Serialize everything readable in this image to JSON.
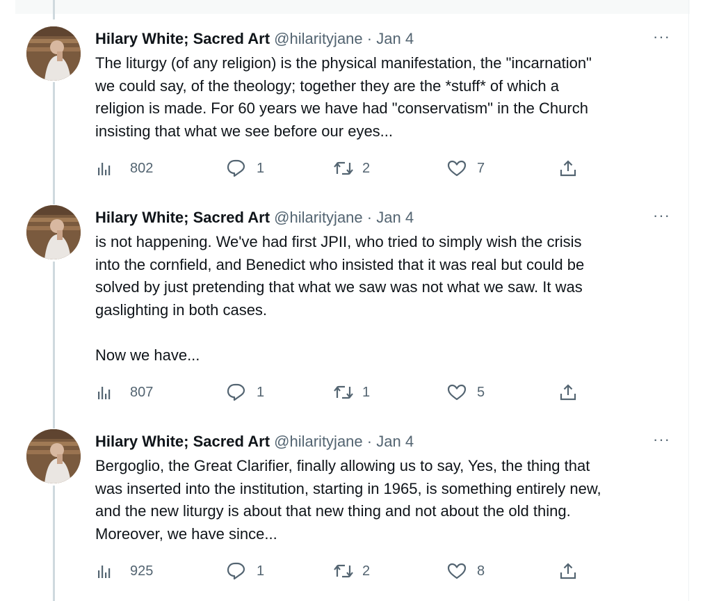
{
  "tweets": [
    {
      "author": "Hilary White; Sacred Art",
      "handle": "@hilarityjane",
      "separator": "·",
      "date": "Jan 4",
      "more": "···",
      "text": "The liturgy (of any religion) is the physical manifestation, the \"incarnation\"\nwe could say, of the theology; together they are the *stuff* of which a\nreligion is made. For 60 years we have had \"conservatism\" in the Church\ninsisting that what we see before our eyes...",
      "views": "802",
      "replies": "1",
      "retweets": "2",
      "likes": "7"
    },
    {
      "author": "Hilary White; Sacred Art",
      "handle": "@hilarityjane",
      "separator": "·",
      "date": "Jan 4",
      "more": "···",
      "text": "is not happening. We've had first JPII, who tried to simply wish the crisis\ninto the cornfield, and Benedict who insisted that it was real but could be\nsolved by just pretending that what we saw was not what we saw. It was\ngaslighting in both cases.\n\nNow we have...",
      "views": "807",
      "replies": "1",
      "retweets": "1",
      "likes": "5"
    },
    {
      "author": "Hilary White; Sacred Art",
      "handle": "@hilarityjane",
      "separator": "·",
      "date": "Jan 4",
      "more": "···",
      "text": "Bergoglio, the Great Clarifier, finally allowing us to say, Yes, the thing that\nwas inserted into the institution, starting in 1965, is something entirely new,\nand the new liturgy is about that new thing and not about the old thing.\nMoreover, we have since...",
      "views": "925",
      "replies": "1",
      "retweets": "2",
      "likes": "8"
    }
  ],
  "colors": {
    "text": "#0f1419",
    "secondary": "#536471",
    "thread_line": "#cfd9de"
  },
  "icons": [
    "views-icon",
    "reply-icon",
    "retweet-icon",
    "like-icon",
    "share-icon",
    "more-icon"
  ]
}
